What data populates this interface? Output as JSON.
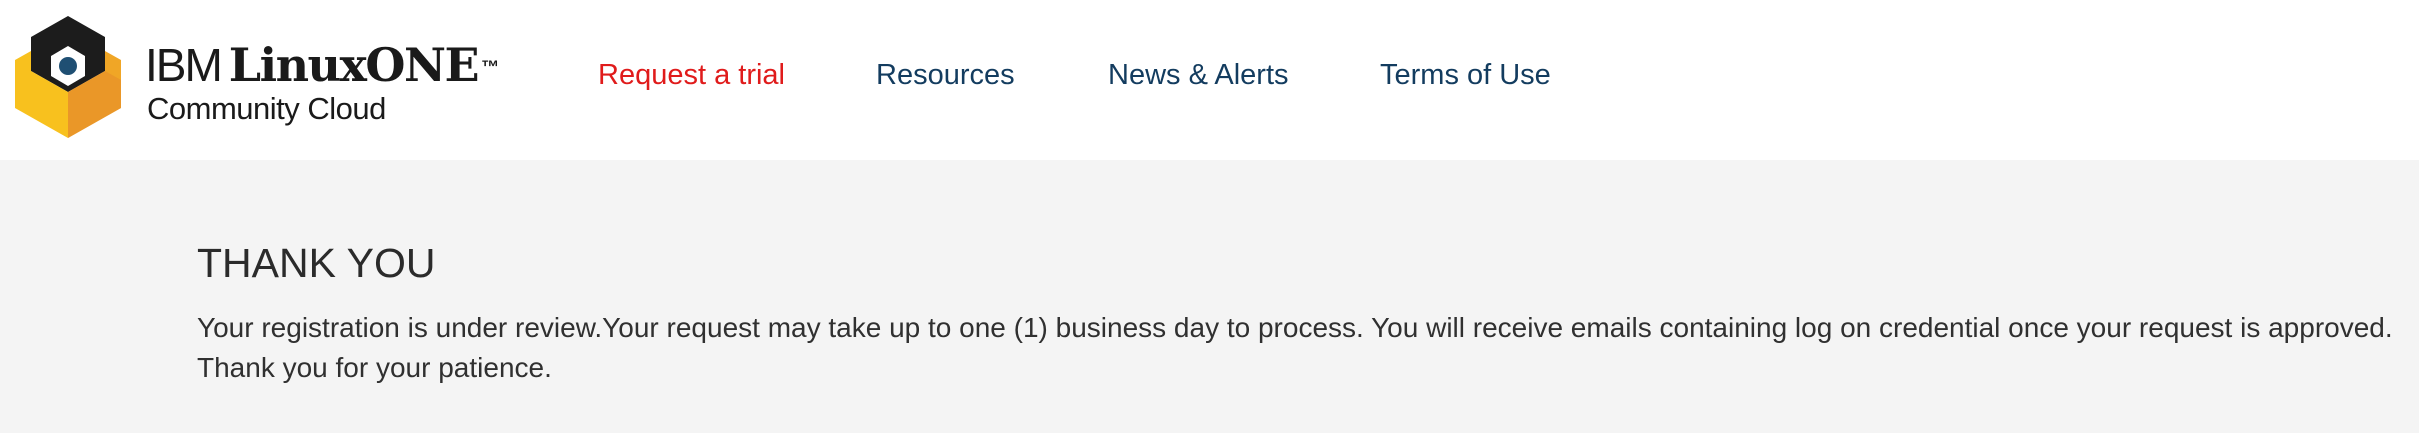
{
  "header": {
    "logo": {
      "ibm": "IBM",
      "brand": "LinuxONE",
      "trademark": "™",
      "subtitle": "Community Cloud",
      "colors": {
        "hex_dark": "#1c1c1c",
        "hex_light": "#f8c11e",
        "hex_mid": "#f0a626",
        "hex_deep": "#e58a2a",
        "dot": "#1f4f73"
      }
    },
    "nav": [
      {
        "label": "Request a trial",
        "active": true
      },
      {
        "label": "Resources",
        "active": false
      },
      {
        "label": "News & Alerts",
        "active": false
      },
      {
        "label": "Terms of Use",
        "active": false
      }
    ],
    "colors": {
      "nav_link": "#133c5f",
      "nav_active": "#e01b1b"
    }
  },
  "main": {
    "title": "THANK YOU",
    "message_line1": "Your registration is under review.Your request may take up to one (1) business day to process. You will receive emails containing log on credential once your request is approved.",
    "message_line2": "Thank you for your patience.",
    "background": "#f4f4f4"
  }
}
